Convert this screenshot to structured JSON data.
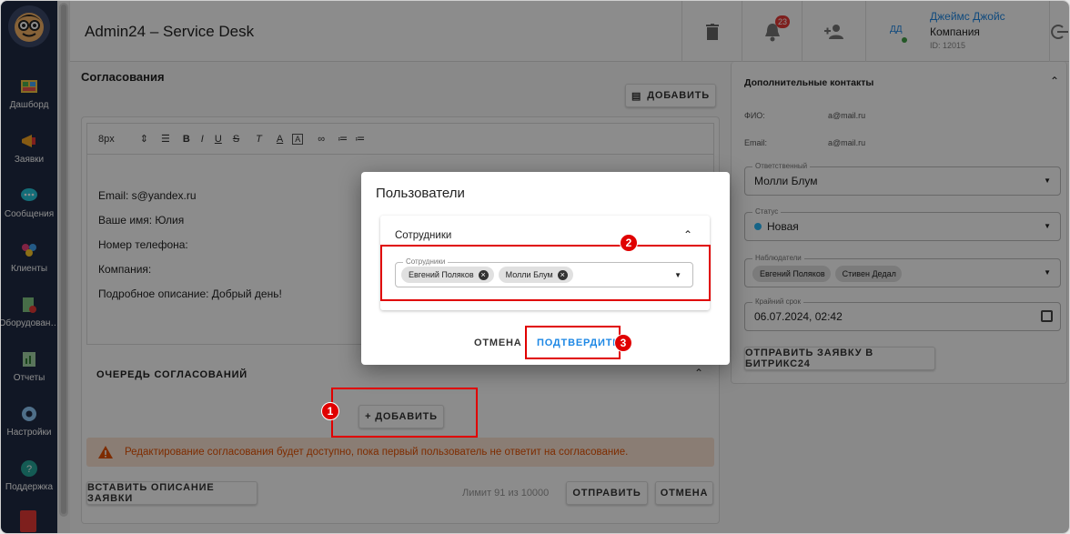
{
  "app": {
    "title": "Admin24 – Service Desk"
  },
  "colors": {
    "sidebar": "#1f2a44",
    "accent": "#1e88e5",
    "danger": "#e00000",
    "warning": "#e65100"
  },
  "sidebar": {
    "items": [
      {
        "label": "Дашборд",
        "icon": "dashboard-icon"
      },
      {
        "label": "Заявки",
        "icon": "megaphone-icon"
      },
      {
        "label": "Сообщения",
        "icon": "chat-icon"
      },
      {
        "label": "Клиенты",
        "icon": "clients-icon"
      },
      {
        "label": "Оборудован…",
        "icon": "equipment-icon"
      },
      {
        "label": "Отчеты",
        "icon": "reports-icon"
      },
      {
        "label": "Настройки",
        "icon": "gear-icon"
      },
      {
        "label": "Поддержка",
        "icon": "help-icon"
      }
    ]
  },
  "header": {
    "notifications_count": "23",
    "user": {
      "initials": "ДД",
      "name": "Джеймс Джойс",
      "company": "Компания",
      "id": "ID: 12015"
    }
  },
  "approvals": {
    "title": "Согласования",
    "add_label": "ДОБАВИТЬ",
    "editor": {
      "font_size": "8px",
      "lines": [
        "Email: s@yandex.ru",
        "Ваше имя: Юлия",
        "Номер телефона:",
        "Компания:",
        "Подробное описание: Добрый день!"
      ]
    },
    "queue_title": "ОЧЕРЕДЬ СОГЛАСОВАНИЙ",
    "queue_add_label": "+ ДОБАВИТЬ",
    "warning_text": "Редактирование согласования будет доступно, пока первый пользователь не ответит на согласование.",
    "insert_description_label": "ВСТАВИТЬ ОПИСАНИЕ ЗАЯВКИ",
    "limit_text": "Лимит 91 из 10000",
    "send_label": "ОТПРАВИТЬ",
    "cancel_label": "ОТМЕНА"
  },
  "right_panel": {
    "contacts_title": "Дополнительные контакты",
    "fio_label": "ФИО:",
    "fio_value": "a@mail.ru",
    "email_label": "Email:",
    "email_value": "a@mail.ru",
    "responsible_label": "Ответственный",
    "responsible_value": "Молли Блум",
    "status_label": "Статус",
    "status_value": "Новая",
    "observers_label": "Наблюдатели",
    "observers": [
      "Евгений Поляков",
      "Стивен Дедал"
    ],
    "deadline_label": "Крайний срок",
    "deadline_value": "06.07.2024, 02:42",
    "bitrix_label": "ОТПРАВИТЬ ЗАЯВКУ В БИТРИКС24"
  },
  "dialog": {
    "title": "Пользователи",
    "section_title": "Сотрудники",
    "field_label": "Сотрудники",
    "chips": [
      "Евгений Поляков",
      "Молли Блум"
    ],
    "cancel_label": "ОТМЕНА",
    "confirm_label": "ПОДТВЕРДИТЬ"
  },
  "markers": [
    "1",
    "2",
    "3"
  ]
}
